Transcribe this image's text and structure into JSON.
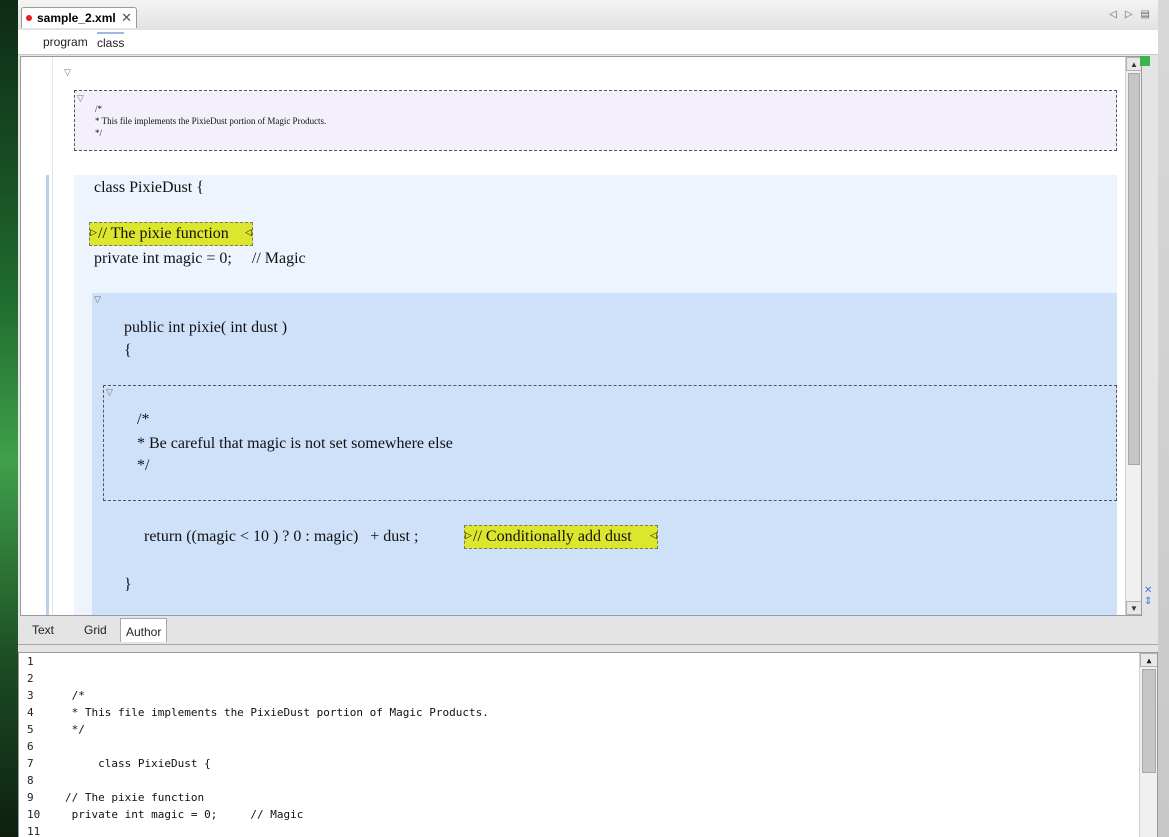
{
  "editor_tab": {
    "filename": "sample_2.xml",
    "close_glyph": "✕"
  },
  "nav": {
    "prev": "◁",
    "next": "▷",
    "list": "▤"
  },
  "subtabs": [
    "program",
    "class"
  ],
  "author": {
    "header_comment": [
      "/*",
      "* This file implements the PixieDust portion of Magic Products.",
      "*/"
    ],
    "class_decl": "class PixieDust {",
    "highlight_comment": "// The pixie function",
    "field_line": "private int magic = 0;     // Magic",
    "method_sig": "public int pixie( int dust )",
    "open_brace": "{",
    "inner_comment": [
      "/*",
      "* Be careful that magic is not set somewhere else",
      "*/"
    ],
    "return_line": "return ((magic < 10 ) ? 0 : magic)   + dust ;",
    "return_comment": "// Conditionally add dust",
    "close_brace": "}"
  },
  "modes": [
    "Text",
    "Grid",
    "Author"
  ],
  "text_lines": [
    {
      "num": "1",
      "code": ""
    },
    {
      "num": "2",
      "code": ""
    },
    {
      "num": "3",
      "code": " /*"
    },
    {
      "num": "4",
      "code": " * This file implements the PixieDust portion of Magic Products."
    },
    {
      "num": "5",
      "code": " */"
    },
    {
      "num": "6",
      "code": ""
    },
    {
      "num": "7",
      "code": "     class PixieDust {"
    },
    {
      "num": "8",
      "code": ""
    },
    {
      "num": "9",
      "code": "// The pixie function"
    },
    {
      "num": "10",
      "code": " private int magic = 0;     // Magic"
    },
    {
      "num": "11",
      "code": ""
    }
  ],
  "colors": {
    "highlight": "#dce62c",
    "method_bg": "#cfe0f9",
    "class_bg": "#eef4fd",
    "comment_bg": "#f3f0fb"
  }
}
